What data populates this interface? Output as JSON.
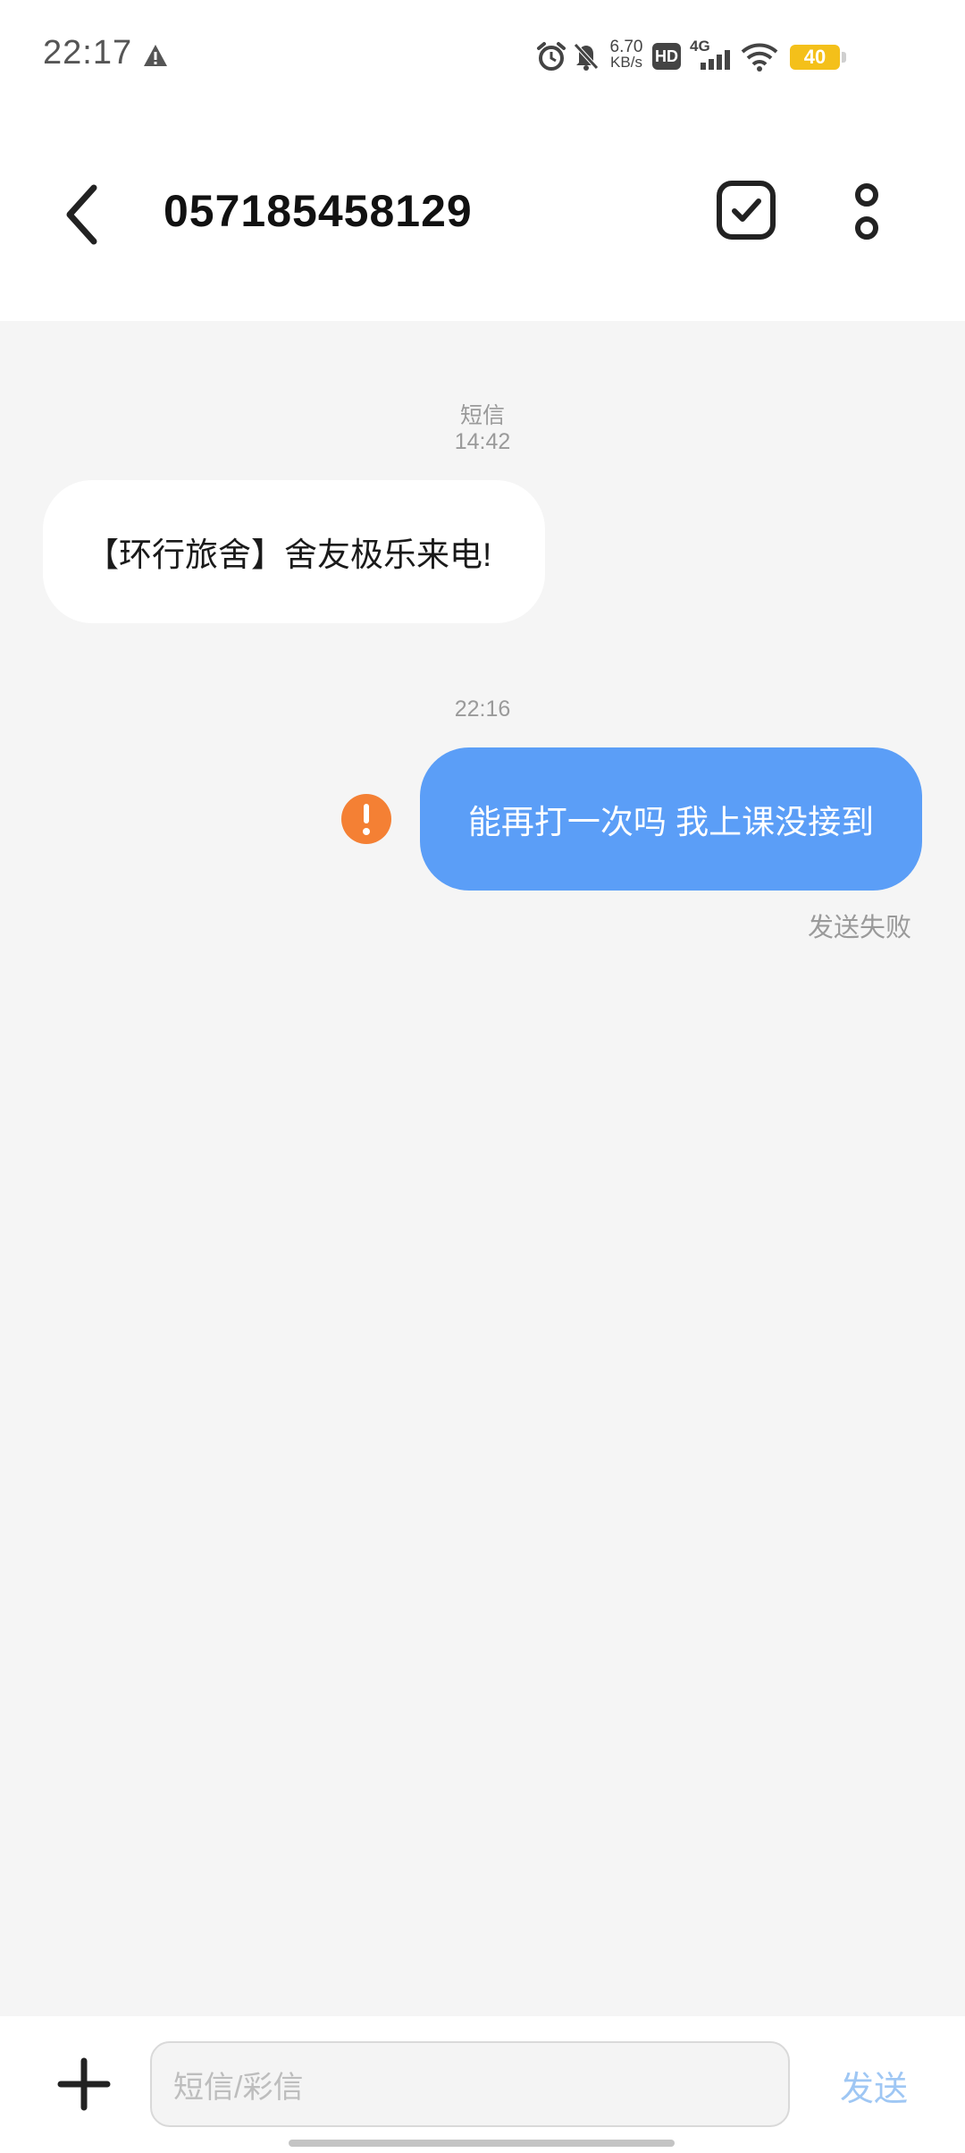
{
  "status_bar": {
    "time": "22:17",
    "net_speed_value": "6.70",
    "net_speed_unit": "KB/s",
    "network": "4G",
    "hd_label": "HD",
    "battery_level": "40",
    "icons": [
      "warning-icon",
      "alarm-icon",
      "mute-icon",
      "hd-icon",
      "signal-icon",
      "wifi-icon",
      "battery-icon"
    ]
  },
  "header": {
    "title": "057185458129"
  },
  "conversation": {
    "first_label": "短信",
    "first_time": "14:42",
    "incoming_message": "【环行旅舍】舍友极乐来电!",
    "second_time": "22:16",
    "outgoing_message": "能再打一次吗 我上课没接到",
    "failed_status": "发送失败"
  },
  "input_bar": {
    "placeholder": "短信/彩信",
    "send_label": "发送"
  },
  "colors": {
    "outgoing_bubble": "#5b9ef7",
    "error": "#f48034",
    "send_disabled": "#9fc7f4",
    "battery": "#f4c01a"
  }
}
